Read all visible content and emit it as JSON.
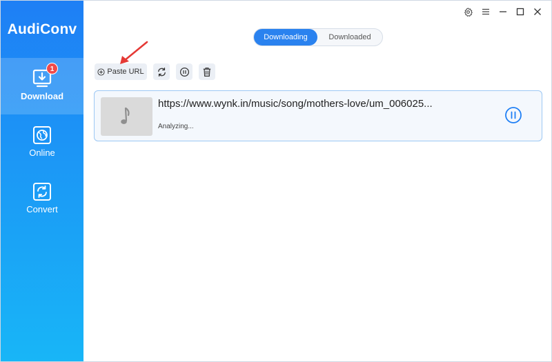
{
  "app": {
    "title": "AudiConv"
  },
  "sidebar": {
    "items": [
      {
        "label": "Download",
        "badge": "1",
        "icon": "download-icon",
        "active": true
      },
      {
        "label": "Online",
        "icon": "globe-icon",
        "active": false
      },
      {
        "label": "Convert",
        "icon": "convert-icon",
        "active": false
      }
    ]
  },
  "window_controls": [
    "settings-icon",
    "menu-icon",
    "minimize-icon",
    "maximize-icon",
    "close-icon"
  ],
  "tabs": {
    "downloading": "Downloading",
    "downloaded": "Downloaded",
    "active": "downloading"
  },
  "toolbar": {
    "paste_url_label": "Paste URL",
    "buttons": [
      "refresh-icon",
      "pause-all-icon",
      "delete-icon"
    ]
  },
  "downloads": [
    {
      "url": "https://www.wynk.in/music/song/mothers-love/um_006025...",
      "status": "Analyzing...",
      "thumbnail_icon": "music-note-icon"
    }
  ],
  "colors": {
    "sidebar_top": "#1e7ff5",
    "sidebar_bottom": "#18b6f7",
    "accent": "#2a82ef",
    "badge": "#f04a4a",
    "arrow": "#e53935"
  }
}
